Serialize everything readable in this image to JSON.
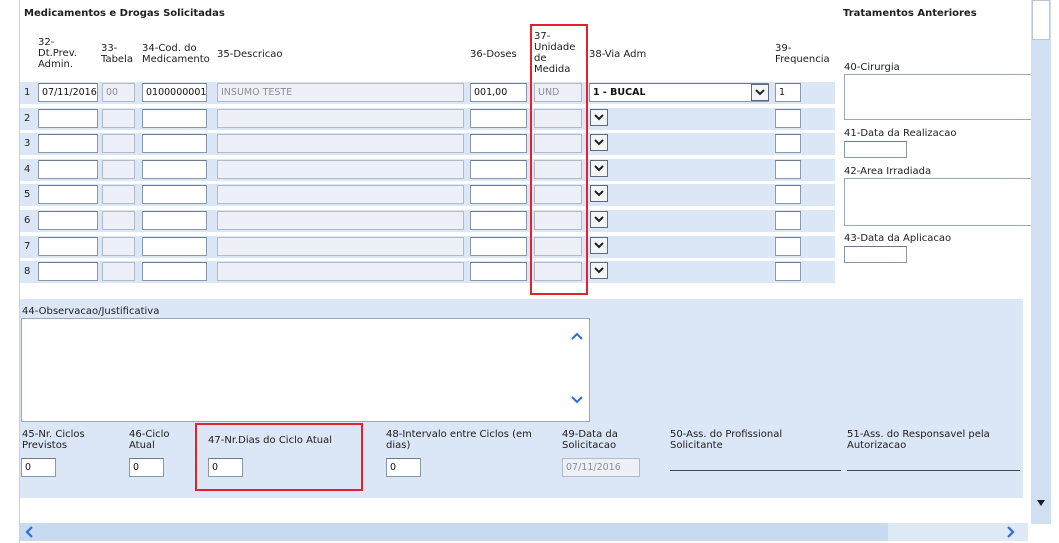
{
  "section": {
    "title": "Medicamentos e Drogas Solicitadas",
    "side_title": "Tratamentos Anteriores"
  },
  "columns": {
    "c32": "32-\nDt.Prev.\nAdmin.",
    "c33": "33-\nTabela",
    "c34": "34-Cod. do\nMedicamento",
    "c35": "35-Descricao",
    "c36": "36-Doses",
    "c37": "37-\nUnidade\nde\nMedida",
    "c38": "38-Via Adm",
    "c39": "39-\nFrequencia"
  },
  "rows": [
    {
      "num": "1",
      "date": "07/11/2016",
      "tabela": "00",
      "cod": "0100000001",
      "descricao": "INSUMO TESTE",
      "doses": "001,00",
      "unidade": "UND",
      "via": "1 - BUCAL",
      "freq": "1"
    },
    {
      "num": "2",
      "date": "",
      "tabela": "",
      "cod": "",
      "descricao": "",
      "doses": "",
      "unidade": "",
      "via": "",
      "freq": ""
    },
    {
      "num": "3",
      "date": "",
      "tabela": "",
      "cod": "",
      "descricao": "",
      "doses": "",
      "unidade": "",
      "via": "",
      "freq": ""
    },
    {
      "num": "4",
      "date": "",
      "tabela": "",
      "cod": "",
      "descricao": "",
      "doses": "",
      "unidade": "",
      "via": "",
      "freq": ""
    },
    {
      "num": "5",
      "date": "",
      "tabela": "",
      "cod": "",
      "descricao": "",
      "doses": "",
      "unidade": "",
      "via": "",
      "freq": ""
    },
    {
      "num": "6",
      "date": "",
      "tabela": "",
      "cod": "",
      "descricao": "",
      "doses": "",
      "unidade": "",
      "via": "",
      "freq": ""
    },
    {
      "num": "7",
      "date": "",
      "tabela": "",
      "cod": "",
      "descricao": "",
      "doses": "",
      "unidade": "",
      "via": "",
      "freq": ""
    },
    {
      "num": "8",
      "date": "",
      "tabela": "",
      "cod": "",
      "descricao": "",
      "doses": "",
      "unidade": "",
      "via": "",
      "freq": ""
    }
  ],
  "tratamentos": {
    "cirurgia_label": "40-Cirurgia",
    "data_realizacao_label": "41-Data da Realizacao",
    "area_irradiada_label": "42-Area Irradiada",
    "data_aplicacao_label": "43-Data da Aplicacao"
  },
  "observacao": {
    "label": "44-Observacao/Justificativa",
    "value": ""
  },
  "bottom": {
    "f45_label": "45-Nr. Ciclos\nPrevistos",
    "f45_value": "0",
    "f46_label": "46-Ciclo\nAtual",
    "f46_value": "0",
    "f47_label": "47-Nr.Dias do Ciclo Atual",
    "f47_value": "0",
    "f48_label": "48-Intervalo entre Ciclos (em\ndias)",
    "f48_value": "0",
    "f49_label": "49-Data da\nSolicitacao",
    "f49_value": "07/11/2016",
    "f50_label": "50-Ass. do Profissional\nSolicitante",
    "f51_label": "51-Ass. do Responsavel pela\nAutorizacao"
  },
  "icons": {
    "dropdown": "chevron-down-icon",
    "scroll_up": "chevron-up-icon",
    "scroll_down": "chevron-down-icon",
    "scroll_left": "chevron-left-icon",
    "scroll_right": "chevron-right-icon"
  },
  "colors": {
    "band": "#dbe6f6",
    "highlight": "#e3222c",
    "scroll_arrow": "#2b6fd6"
  }
}
